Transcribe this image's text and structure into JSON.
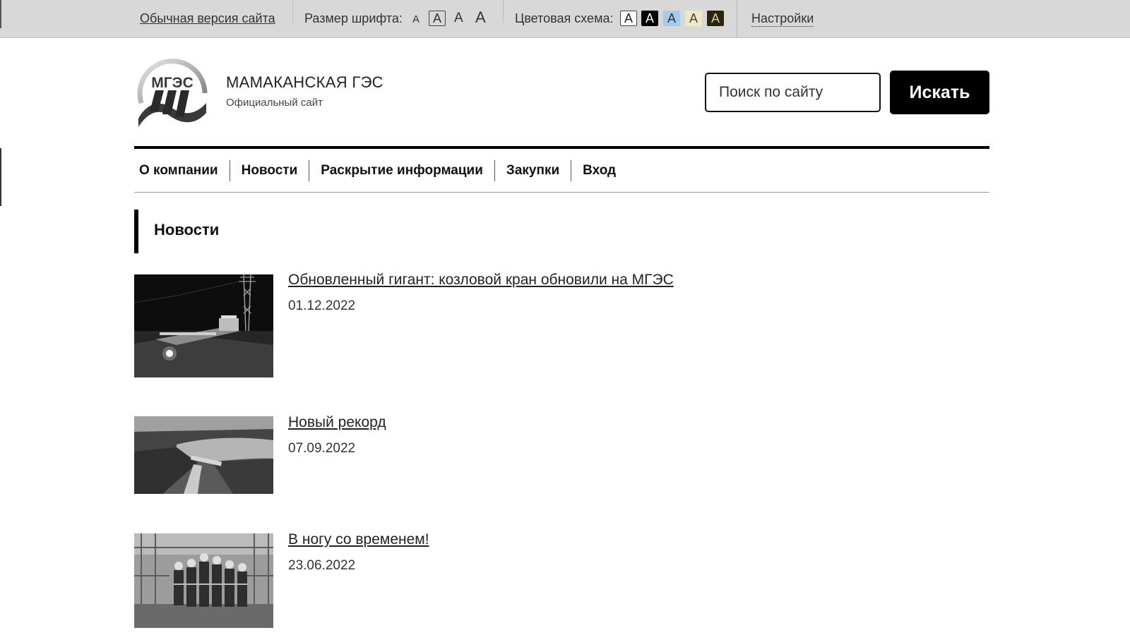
{
  "accessibility_bar": {
    "normal_version": "Обычная версия сайта",
    "font_size_label": "Размер шрифта:",
    "font_sizes": [
      "A",
      "A",
      "A",
      "A"
    ],
    "color_scheme_label": "Цветовая схема:",
    "color_schemes": [
      {
        "label": "A",
        "bg": "#ffffff",
        "fg": "#222222"
      },
      {
        "label": "A",
        "bg": "#000000",
        "fg": "#ffffff"
      },
      {
        "label": "A",
        "bg": "#a9cbea",
        "fg": "#223344"
      },
      {
        "label": "A",
        "bg": "#efe7c6",
        "fg": "#444444"
      },
      {
        "label": "A",
        "bg": "#2b2410",
        "fg": "#d6cf9c"
      }
    ],
    "settings": "Настройки"
  },
  "header": {
    "logo_text": "МГЭС",
    "title": "МАМАКАНСКАЯ ГЭС",
    "subtitle": "Официальный сайт",
    "search_placeholder": "Поиск по сайту",
    "search_button": "Искать"
  },
  "nav": {
    "items": [
      "О компании",
      "Новости",
      "Раскрытие информации",
      "Закупки",
      "Вход"
    ]
  },
  "section": {
    "title": "Новости"
  },
  "news": [
    {
      "title": "Обновленный гигант: козловой кран обновили на МГЭС",
      "date": "01.12.2022",
      "image": "night-dam-photo"
    },
    {
      "title": "Новый рекорд",
      "date": "07.09.2022",
      "image": "aerial-dam-photo"
    },
    {
      "title": "В ногу со временем!",
      "date": "23.06.2022",
      "image": "workers-group-photo"
    }
  ]
}
